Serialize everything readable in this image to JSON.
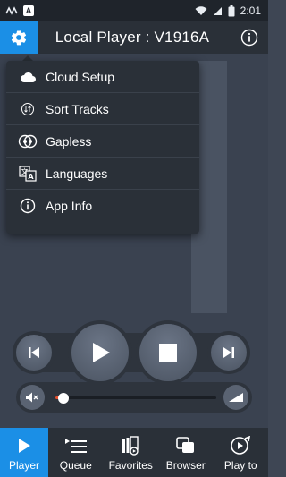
{
  "statusbar": {
    "time": "2:01",
    "badge": "A"
  },
  "header": {
    "title": "Local Player : V1916A"
  },
  "menu": {
    "items": [
      {
        "label": "Cloud Setup",
        "icon": "cloud-icon"
      },
      {
        "label": "Sort Tracks",
        "icon": "sort-icon"
      },
      {
        "label": "Gapless",
        "icon": "gapless-icon"
      },
      {
        "label": "Languages",
        "icon": "languages-icon"
      },
      {
        "label": "App Info",
        "icon": "info-icon"
      }
    ]
  },
  "volume": {
    "level": 0.05
  },
  "nav": {
    "items": [
      {
        "label": "Player",
        "icon": "play-icon",
        "active": true
      },
      {
        "label": "Queue",
        "icon": "queue-icon"
      },
      {
        "label": "Favorites",
        "icon": "favorites-icon"
      },
      {
        "label": "Browser",
        "icon": "browser-icon"
      },
      {
        "label": "Play to",
        "icon": "play-to-icon"
      }
    ]
  },
  "colors": {
    "accent": "#1b8fe6",
    "volume_fill": "#e5502e"
  }
}
